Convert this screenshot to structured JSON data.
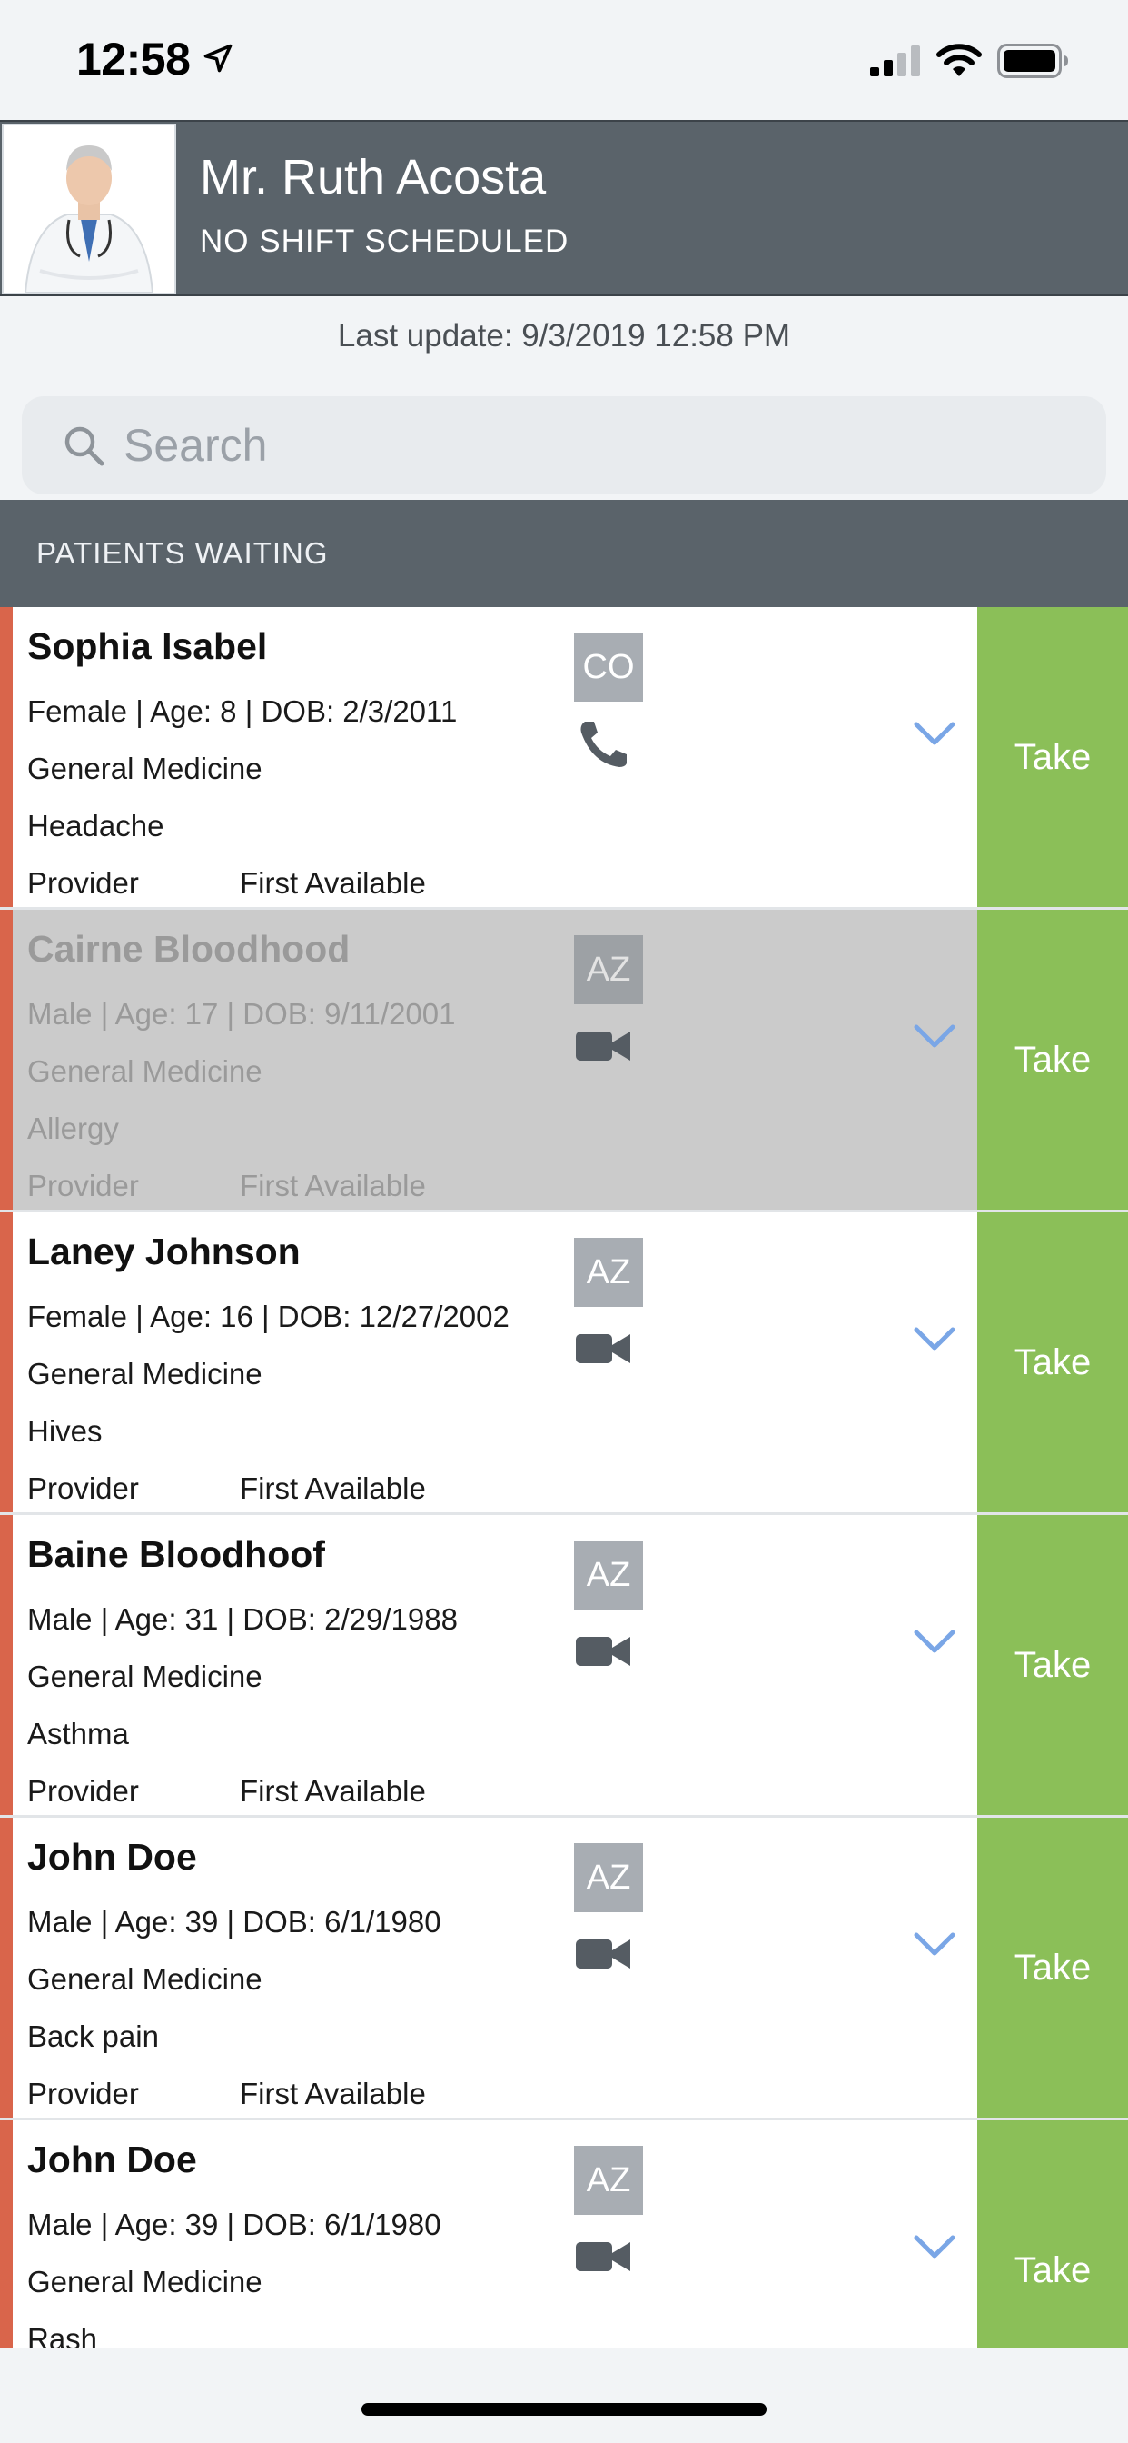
{
  "status_bar": {
    "time": "12:58",
    "icons": [
      "location-arrow-icon",
      "cellular-signal-icon",
      "wifi-icon",
      "battery-icon"
    ]
  },
  "header": {
    "name": "Mr. Ruth Acosta",
    "shift": "NO SHIFT SCHEDULED"
  },
  "last_update": "Last update: 9/3/2019 12:58 PM",
  "search": {
    "placeholder": "Search"
  },
  "section": {
    "title": "PATIENTS WAITING"
  },
  "colors": {
    "header_bg": "#5a636a",
    "accent": "#d9654b",
    "take_button": "#8bbf58",
    "chevron": "#7aa6e6",
    "dimmed_row": "#cbcbcb"
  },
  "patients": [
    {
      "name": "Sophia Isabel",
      "details": "Female | Age: 8 | DOB: 2/3/2011",
      "specialty": "General Medicine",
      "reason": "Headache",
      "provider_label": "Provider",
      "provider": "First Available",
      "state": "CO",
      "mode_icon": "phone-icon",
      "take_label": "Take"
    },
    {
      "name": "Cairne Bloodhood",
      "details": "Male | Age: 17 | DOB: 9/11/2001",
      "specialty": "General Medicine",
      "reason": "Allergy",
      "provider_label": "Provider",
      "provider": "First Available",
      "state": "AZ",
      "mode_icon": "video-camera-icon",
      "take_label": "Take"
    },
    {
      "name": "Laney Johnson",
      "details": "Female | Age: 16 | DOB: 12/27/2002",
      "specialty": "General Medicine",
      "reason": "Hives",
      "provider_label": "Provider",
      "provider": "First Available",
      "state": "AZ",
      "mode_icon": "video-camera-icon",
      "take_label": "Take"
    },
    {
      "name": "Baine Bloodhoof",
      "details": "Male | Age: 31 | DOB: 2/29/1988",
      "specialty": "General Medicine",
      "reason": "Asthma",
      "provider_label": "Provider",
      "provider": "First Available",
      "state": "AZ",
      "mode_icon": "video-camera-icon",
      "take_label": "Take"
    },
    {
      "name": "John Doe",
      "details": "Male | Age: 39 | DOB: 6/1/1980",
      "specialty": "General Medicine",
      "reason": "Back pain",
      "provider_label": "Provider",
      "provider": "First Available",
      "state": "AZ",
      "mode_icon": "video-camera-icon",
      "take_label": "Take"
    },
    {
      "name": "John Doe",
      "details": "Male | Age: 39 | DOB: 6/1/1980",
      "specialty": "General Medicine",
      "reason": "Rash",
      "state": "AZ",
      "mode_icon": "video-camera-icon",
      "take_label": "Take"
    }
  ]
}
